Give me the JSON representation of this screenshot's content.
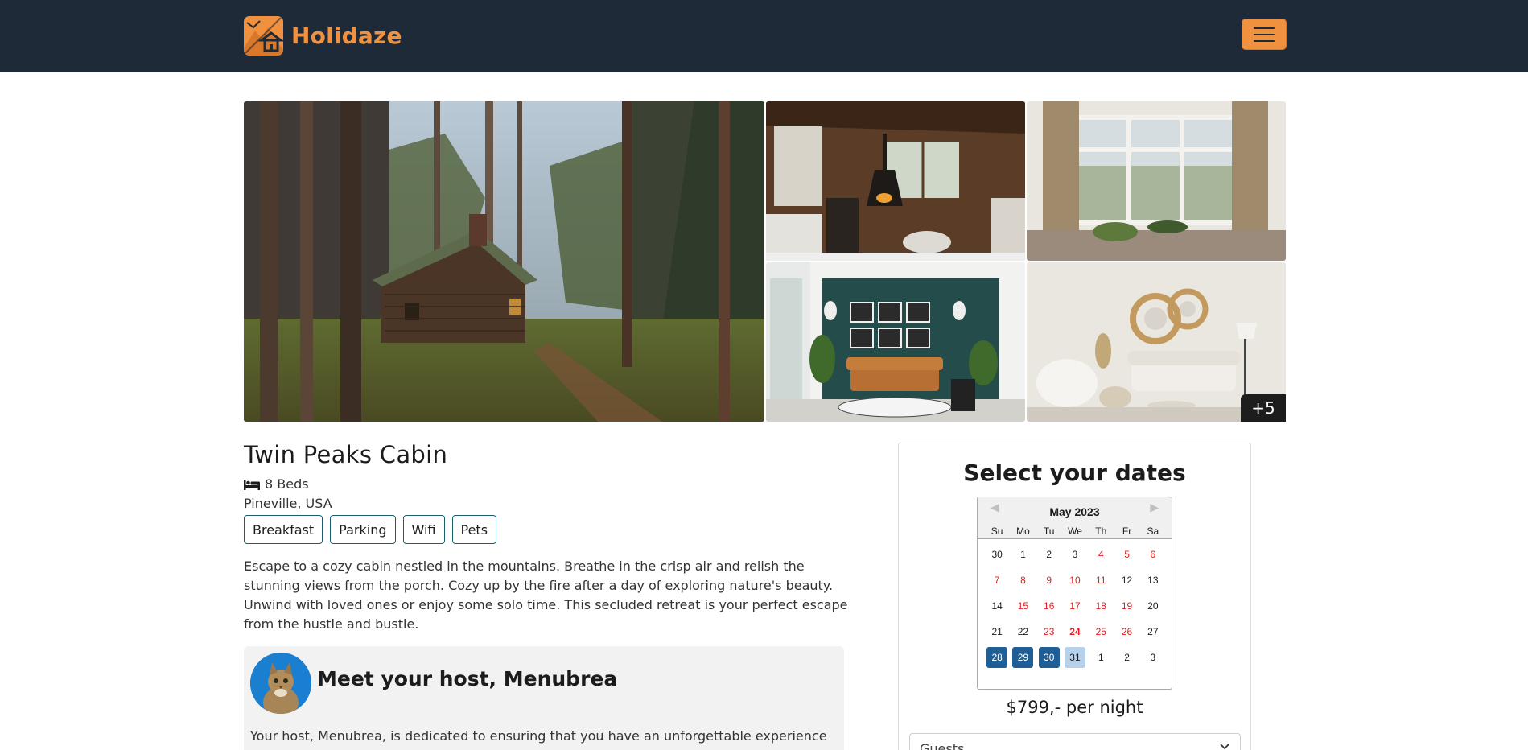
{
  "navbar": {
    "brand": "Holidaze",
    "logo_icon": "cabin-logo-icon",
    "menu_icon": "hamburger-icon",
    "accent_color": "#f0913f",
    "background_color": "#1f2a38"
  },
  "gallery": {
    "more_label": "+5"
  },
  "venue": {
    "title": "Twin Peaks Cabin",
    "beds_icon": "bed-icon",
    "beds": "8 Beds",
    "location": "Pineville, USA",
    "amenities": [
      "Breakfast",
      "Parking",
      "Wifi",
      "Pets"
    ],
    "description": "Escape to a cozy cabin nestled in the mountains. Breathe in the crisp air and relish the stunning views from the porch. Cozy up by the fire after a day of exploring nature's beauty. Unwind with loved ones or enjoy some solo time. This secluded retreat is your perfect escape from the hustle and bustle."
  },
  "host": {
    "title": "Meet your host, Menubrea",
    "text": "Your host, Menubrea, is dedicated to ensuring that you have an unforgettable experience"
  },
  "booking": {
    "title": "Select your dates",
    "calendar": {
      "month": "May 2023",
      "prev_icon": "chevron-left-icon",
      "next_icon": "chevron-right-icon",
      "weekdays": [
        "Su",
        "Mo",
        "Tu",
        "We",
        "Th",
        "Fr",
        "Sa"
      ],
      "days": [
        {
          "d": "30",
          "s": "other"
        },
        {
          "d": "1",
          "s": ""
        },
        {
          "d": "2",
          "s": ""
        },
        {
          "d": "3",
          "s": ""
        },
        {
          "d": "4",
          "s": "booked"
        },
        {
          "d": "5",
          "s": "booked"
        },
        {
          "d": "6",
          "s": "booked"
        },
        {
          "d": "7",
          "s": "booked"
        },
        {
          "d": "8",
          "s": "booked"
        },
        {
          "d": "9",
          "s": "booked"
        },
        {
          "d": "10",
          "s": "booked"
        },
        {
          "d": "11",
          "s": "booked"
        },
        {
          "d": "12",
          "s": ""
        },
        {
          "d": "13",
          "s": ""
        },
        {
          "d": "14",
          "s": ""
        },
        {
          "d": "15",
          "s": "booked"
        },
        {
          "d": "16",
          "s": "booked"
        },
        {
          "d": "17",
          "s": "booked"
        },
        {
          "d": "18",
          "s": "booked"
        },
        {
          "d": "19",
          "s": "booked"
        },
        {
          "d": "20",
          "s": ""
        },
        {
          "d": "21",
          "s": ""
        },
        {
          "d": "22",
          "s": ""
        },
        {
          "d": "23",
          "s": "booked"
        },
        {
          "d": "24",
          "s": "today"
        },
        {
          "d": "25",
          "s": "booked"
        },
        {
          "d": "26",
          "s": "booked"
        },
        {
          "d": "27",
          "s": ""
        },
        {
          "d": "28",
          "s": "sel"
        },
        {
          "d": "29",
          "s": "sel"
        },
        {
          "d": "30",
          "s": "sel"
        },
        {
          "d": "31",
          "s": "hov"
        },
        {
          "d": "1",
          "s": "other"
        },
        {
          "d": "2",
          "s": "other"
        },
        {
          "d": "3",
          "s": "other"
        }
      ]
    },
    "price": "$799,- per night",
    "guests_placeholder": "Guests",
    "guests_icon": "chevron-down-icon"
  }
}
